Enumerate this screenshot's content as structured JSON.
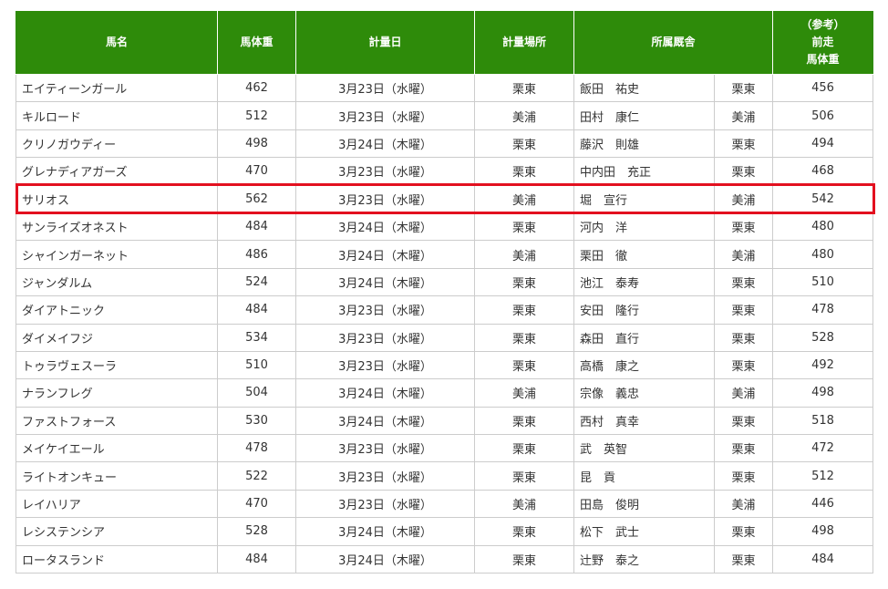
{
  "columns": {
    "horse_name": "馬名",
    "weight": "馬体重",
    "date": "計量日",
    "place": "計量場所",
    "stable": "所属厩舎",
    "prev_note": "（参考）",
    "prev_1": "前走",
    "prev_2": "馬体重"
  },
  "rows": [
    {
      "name": "エイティーンガール",
      "weight": "462",
      "date": "3月23日（水曜）",
      "place": "栗東",
      "trainer": "飯田　祐史",
      "loc": "栗東",
      "prev": "456"
    },
    {
      "name": "キルロード",
      "weight": "512",
      "date": "3月23日（水曜）",
      "place": "美浦",
      "trainer": "田村　康仁",
      "loc": "美浦",
      "prev": "506"
    },
    {
      "name": "クリノガウディー",
      "weight": "498",
      "date": "3月24日（木曜）",
      "place": "栗東",
      "trainer": "藤沢　則雄",
      "loc": "栗東",
      "prev": "494"
    },
    {
      "name": "グレナディアガーズ",
      "weight": "470",
      "date": "3月23日（水曜）",
      "place": "栗東",
      "trainer": "中内田　充正",
      "loc": "栗東",
      "prev": "468"
    },
    {
      "name": "サリオス",
      "weight": "562",
      "date": "3月23日（水曜）",
      "place": "美浦",
      "trainer": "堀　宣行",
      "loc": "美浦",
      "prev": "542"
    },
    {
      "name": "サンライズオネスト",
      "weight": "484",
      "date": "3月24日（木曜）",
      "place": "栗東",
      "trainer": "河内　洋",
      "loc": "栗東",
      "prev": "480"
    },
    {
      "name": "シャインガーネット",
      "weight": "486",
      "date": "3月24日（木曜）",
      "place": "美浦",
      "trainer": "栗田　徹",
      "loc": "美浦",
      "prev": "480"
    },
    {
      "name": "ジャンダルム",
      "weight": "524",
      "date": "3月24日（木曜）",
      "place": "栗東",
      "trainer": "池江　泰寿",
      "loc": "栗東",
      "prev": "510"
    },
    {
      "name": "ダイアトニック",
      "weight": "484",
      "date": "3月23日（水曜）",
      "place": "栗東",
      "trainer": "安田　隆行",
      "loc": "栗東",
      "prev": "478"
    },
    {
      "name": "ダイメイフジ",
      "weight": "534",
      "date": "3月23日（水曜）",
      "place": "栗東",
      "trainer": "森田　直行",
      "loc": "栗東",
      "prev": "528"
    },
    {
      "name": "トゥラヴェスーラ",
      "weight": "510",
      "date": "3月23日（水曜）",
      "place": "栗東",
      "trainer": "高橋　康之",
      "loc": "栗東",
      "prev": "492"
    },
    {
      "name": "ナランフレグ",
      "weight": "504",
      "date": "3月24日（木曜）",
      "place": "美浦",
      "trainer": "宗像　義忠",
      "loc": "美浦",
      "prev": "498"
    },
    {
      "name": "ファストフォース",
      "weight": "530",
      "date": "3月24日（木曜）",
      "place": "栗東",
      "trainer": "西村　真幸",
      "loc": "栗東",
      "prev": "518"
    },
    {
      "name": "メイケイエール",
      "weight": "478",
      "date": "3月23日（水曜）",
      "place": "栗東",
      "trainer": "武　英智",
      "loc": "栗東",
      "prev": "472"
    },
    {
      "name": "ライトオンキュー",
      "weight": "522",
      "date": "3月23日（水曜）",
      "place": "栗東",
      "trainer": "昆　貢",
      "loc": "栗東",
      "prev": "512"
    },
    {
      "name": "レイハリア",
      "weight": "470",
      "date": "3月23日（水曜）",
      "place": "美浦",
      "trainer": "田島　俊明",
      "loc": "美浦",
      "prev": "446"
    },
    {
      "name": "レシステンシア",
      "weight": "528",
      "date": "3月24日（木曜）",
      "place": "栗東",
      "trainer": "松下　武士",
      "loc": "栗東",
      "prev": "498"
    },
    {
      "name": "ロータスランド",
      "weight": "484",
      "date": "3月24日（木曜）",
      "place": "栗東",
      "trainer": "辻野　泰之",
      "loc": "栗東",
      "prev": "484"
    }
  ],
  "highlighted_row": 4,
  "colors": {
    "header_bg": "#2e8b0a",
    "highlight_border": "#e3101f",
    "grid": "#cccccc"
  }
}
